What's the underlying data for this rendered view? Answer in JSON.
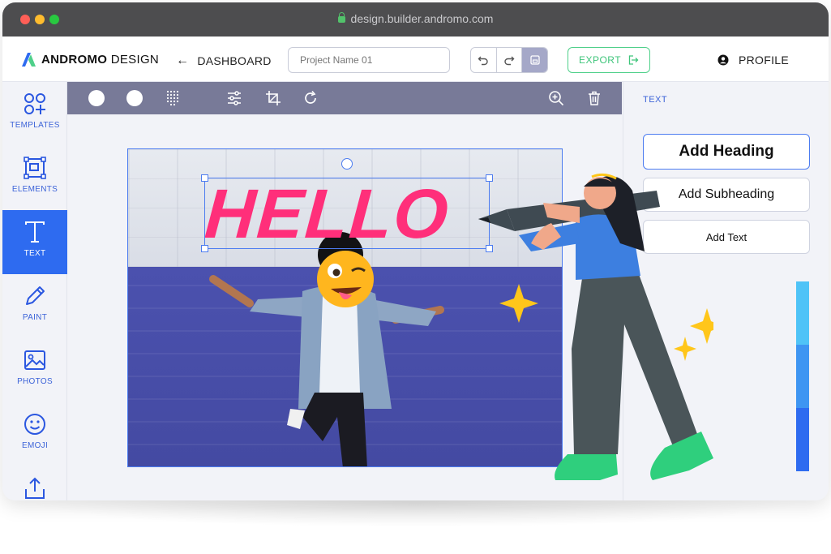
{
  "browser": {
    "url": "design.builder.andromo.com"
  },
  "header": {
    "brand_bold": "ANDROMO",
    "brand_light": " DESIGN",
    "back_label": "DASHBOARD",
    "project_placeholder": "Project Name 01",
    "export_label": "EXPORT",
    "profile_label": "PROFILE"
  },
  "sidebar": {
    "items": [
      {
        "label": "TEMPLATES",
        "icon": "templates-icon"
      },
      {
        "label": "ELEMENTS",
        "icon": "elements-icon"
      },
      {
        "label": "TEXT",
        "icon": "text-icon",
        "active": true
      },
      {
        "label": "PAINT",
        "icon": "pencil-icon"
      },
      {
        "label": "PHOTOS",
        "icon": "image-icon"
      },
      {
        "label": "EMOJI",
        "icon": "smiley-icon"
      },
      {
        "label": "",
        "icon": "upload-icon"
      }
    ]
  },
  "canvas": {
    "headline": "HELLO"
  },
  "text_panel": {
    "title": "TEXT",
    "heading": "Add Heading",
    "subheading": "Add Subheading",
    "text": "Add Text"
  },
  "colors": {
    "accent": "#2e6bf0",
    "toolbar": "#787a98",
    "export": "#3fc57b",
    "headline": "#ff2f7a"
  }
}
